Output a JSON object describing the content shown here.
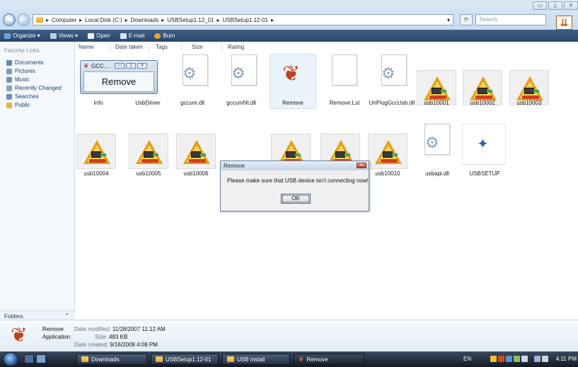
{
  "window": {
    "controls": [
      "▭",
      "▯",
      "✕"
    ]
  },
  "address": {
    "crumbs": [
      "Computer",
      "Local Disk (C:)",
      "Downloads",
      "USBSetup1.12_01",
      "USBSetup1.12-01"
    ],
    "search_placeholder": "Search"
  },
  "toolbar": {
    "organize": "Organize ▾",
    "views": "Views ▾",
    "open": "Open",
    "email": "E-mail",
    "burn": "Burn"
  },
  "nav": {
    "title": "Favorite Links",
    "items": [
      "Documents",
      "Pictures",
      "Music",
      "Recently Changed",
      "Searches",
      "Public"
    ],
    "folders": "Folders"
  },
  "columns": [
    "Name",
    "Date taken",
    "Tags",
    "Size",
    "Rating"
  ],
  "files_row1": [
    {
      "name": "Info",
      "type": "folder"
    },
    {
      "name": "UsbDriver",
      "type": "folder"
    },
    {
      "name": "gccum.dll",
      "type": "dll"
    },
    {
      "name": "gccumNt.dll",
      "type": "dll"
    },
    {
      "name": "Remove",
      "type": "app"
    },
    {
      "name": "Remove.Lst",
      "type": "blank"
    },
    {
      "name": "UnPlugGccUsb.dll",
      "type": "dll"
    },
    {
      "name": "usb10001",
      "type": "usb"
    },
    {
      "name": "usb10002",
      "type": "usb"
    },
    {
      "name": "usb10003",
      "type": "usb"
    }
  ],
  "files_row2": [
    {
      "name": "usb10004",
      "type": "usb"
    },
    {
      "name": "usb10005",
      "type": "usb"
    },
    {
      "name": "usb10006",
      "type": "usb"
    },
    {
      "name": "",
      "type": "usb"
    },
    {
      "name": "",
      "type": "usb"
    },
    {
      "name": "usb10010",
      "type": "usb"
    },
    {
      "name": "usbapi.dll",
      "type": "dll"
    },
    {
      "name": "USBSETUP",
      "type": "setup"
    }
  ],
  "miniwin": {
    "title": "GCC...",
    "body": "Remove"
  },
  "dialog": {
    "title": "Remove",
    "message": "Please make sure that USB device isn't connecting now!",
    "ok": "OK"
  },
  "details": {
    "name": "Remove",
    "type": "Application",
    "modified_label": "Date modified:",
    "modified": "11/28/2007 11:12 AM",
    "size_label": "Size:",
    "size": "483 KB",
    "created_label": "Date created:",
    "created": "9/16/2009 4:08 PM"
  },
  "taskbar": {
    "tasks": [
      "Downloads",
      "USBSetup1.12-01",
      "USB install",
      "Remove"
    ],
    "lang": "EN",
    "clock": "4:11 PM"
  },
  "colors": {
    "toolbar": "#2b4769",
    "warning": "#e2a11a",
    "usb_red": "#d43b1f"
  }
}
